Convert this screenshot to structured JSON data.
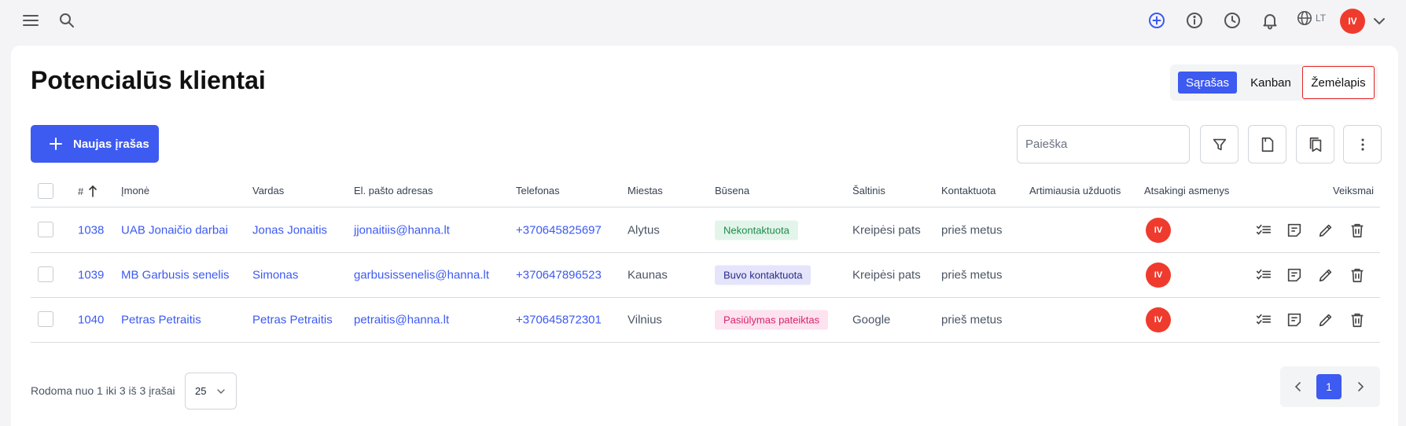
{
  "header": {
    "lang": "LT",
    "user_initials": "IV"
  },
  "page": {
    "title": "Potencialūs klientai"
  },
  "views": {
    "list": "Sąrašas",
    "kanban": "Kanban",
    "map": "Žemėlapis"
  },
  "toolbar": {
    "new_label": "Naujas įrašas",
    "search_placeholder": "Paieška"
  },
  "table": {
    "columns": {
      "id": "#",
      "company": "Įmonė",
      "name": "Vardas",
      "email": "El. pašto adresas",
      "phone": "Telefonas",
      "city": "Miestas",
      "status": "Būsena",
      "source": "Šaltinis",
      "contacted": "Kontaktuota",
      "nearest_task": "Artimiausia užduotis",
      "responsible": "Atsakingi asmenys",
      "actions": "Veiksmai"
    },
    "rows": [
      {
        "id": "1038",
        "company": "UAB Jonaičio darbai",
        "name": "Jonas Jonaitis",
        "email": "jjonaitiis@hanna.lt",
        "phone": "+370645825697",
        "city": "Alytus",
        "status": "Nekontaktuota",
        "source": "Kreipėsi pats",
        "contacted": "prieš metus",
        "responsible": "IV"
      },
      {
        "id": "1039",
        "company": "MB Garbusis senelis",
        "name": "Simonas",
        "email": "garbusissenelis@hanna.lt",
        "phone": "+370647896523",
        "city": "Kaunas",
        "status": "Buvo kontaktuota",
        "source": "Kreipėsi pats",
        "contacted": "prieš metus",
        "responsible": "IV"
      },
      {
        "id": "1040",
        "company": "Petras Petraitis",
        "name": "Petras Petraitis",
        "email": "petraitis@hanna.lt",
        "phone": "+370645872301",
        "city": "Vilnius",
        "status": "Pasiūlymas pateiktas",
        "source": "Google",
        "contacted": "prieš metus",
        "responsible": "IV"
      }
    ]
  },
  "status_colors": {
    "Nekontaktuota": {
      "bg": "#e3f5ea",
      "fg": "#1f8a4c"
    },
    "Buvo kontaktuota": {
      "bg": "#e4e4fb",
      "fg": "#2a2a8a"
    },
    "Pasiūlymas pateiktas": {
      "bg": "#fde2ef",
      "fg": "#d6246e"
    }
  },
  "footer": {
    "summary": "Rodoma nuo 1 iki 3 iš 3 įrašai",
    "per_page": "25",
    "current_page": "1"
  },
  "colors": {
    "accent": "#3d5af1",
    "avatar": "#ef3b2d"
  }
}
